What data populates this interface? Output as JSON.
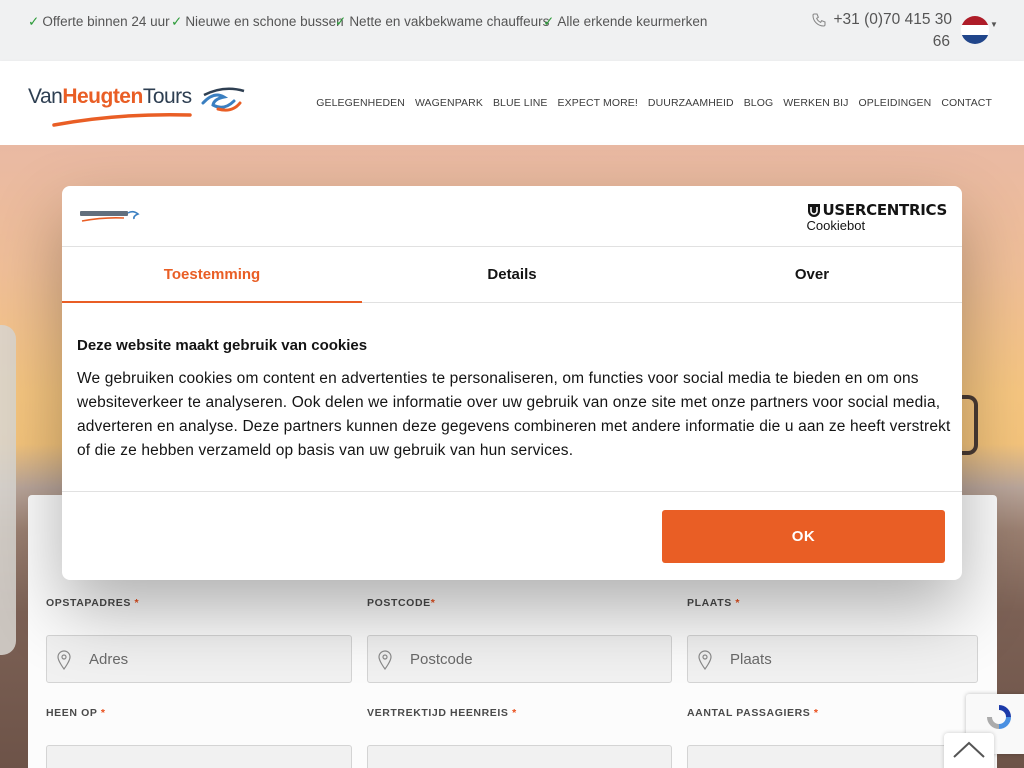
{
  "topbar": {
    "usps": [
      "Offerte binnen 24 uur",
      "Nieuwe en schone bussen",
      "Nette en vakbekwame chauffeurs",
      "Alle erkende keurmerken"
    ],
    "phone_line1": "+31 (0)70 415 30",
    "phone_line2": "66",
    "language_flag": "netherlands-flag"
  },
  "header": {
    "logo_part1": "Van",
    "logo_part2": "Heugten",
    "logo_part3": "Tours",
    "nav": [
      "GELEGENHEDEN",
      "WAGENPARK",
      "BLUE LINE",
      "EXPECT MORE!",
      "DUURZAAMHEID",
      "BLOG",
      "WERKEN BIJ",
      "OPLEIDINGEN",
      "CONTACT"
    ]
  },
  "form": {
    "labels": {
      "address": "OPSTAPADRES",
      "postcode": "POSTCODE",
      "city": "PLAATS",
      "date": "HEEN OP",
      "time": "VERTREKTIJD HEENREIS",
      "passengers": "AANTAL PASSAGIERS",
      "required_mark": "*"
    },
    "placeholders": {
      "address": "Adres",
      "postcode": "Postcode",
      "city": "Plaats"
    }
  },
  "cookie": {
    "provider_name": "USERCENTRICS",
    "provider_sub": "Cookiebot",
    "tabs": [
      "Toestemming",
      "Details",
      "Over"
    ],
    "active_tab": "Toestemming",
    "title": "Deze website maakt gebruik van cookies",
    "body": "We gebruiken cookies om content en advertenties te personaliseren, om functies voor social media te bieden en om ons websiteverkeer te analyseren. Ook delen we informatie over uw gebruik van onze site met onze partners voor social media, adverteren en analyse. Deze partners kunnen deze gegevens combineren met andere informatie die u aan ze heeft verstrekt of die ze hebben verzameld op basis van uw gebruik van hun services.",
    "ok_label": "OK"
  },
  "colors": {
    "brand_orange": "#e95e25",
    "brand_navy": "#2e3f52",
    "tick_green": "#2e9c3b"
  }
}
